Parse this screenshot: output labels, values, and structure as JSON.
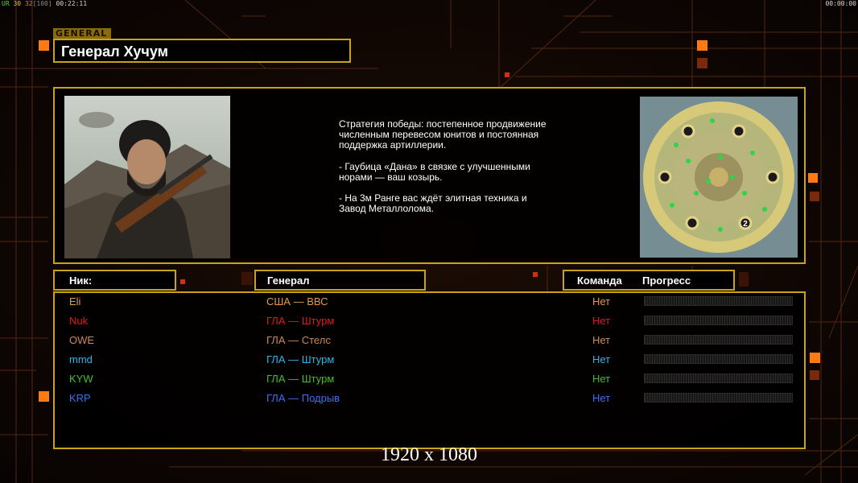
{
  "hud": {
    "tag": "UR",
    "fps": "30",
    "fps_max": "32",
    "fps_cap": "[100]",
    "clock": "00:22:11",
    "timer": "00:00:00"
  },
  "general": {
    "tag": "GENERAL",
    "name": "Генерал Хучум",
    "strategy": [
      "Стратегия победы: постепенное продвижение численным перевесом юнитов и постоянная поддержка артиллерии.",
      "- Гаубица «Дана» в связке с улучшенными норами — ваш козырь.",
      "- На 3м Ранге вас ждёт элитная техника и Завод Металлолома."
    ],
    "map_marker": "2"
  },
  "headers": {
    "nick": "Ник:",
    "general": "Генерал",
    "team": "Команда",
    "progress": "Прогресс"
  },
  "players": [
    {
      "nick": "Eli",
      "general": "США — ВВС",
      "team": "Нет",
      "color": "#e39a47"
    },
    {
      "nick": "Nuk",
      "general": "ГЛА — Штурм",
      "team": "Нет",
      "color": "#e11919"
    },
    {
      "nick": "OWE",
      "general": "ГЛА — Стелс",
      "team": "Нет",
      "color": "#c98a5a"
    },
    {
      "nick": "mmd",
      "general": "ГЛА — Штурм",
      "team": "Нет",
      "color": "#2fb4e6"
    },
    {
      "nick": "KYW",
      "general": "ГЛА — Штурм",
      "team": "Нет",
      "color": "#3ec12a"
    },
    {
      "nick": "KRP",
      "general": "ГЛА — Подрыв",
      "team": "Нет",
      "color": "#3c6ff0"
    }
  ],
  "resolution": "1920 x 1080"
}
